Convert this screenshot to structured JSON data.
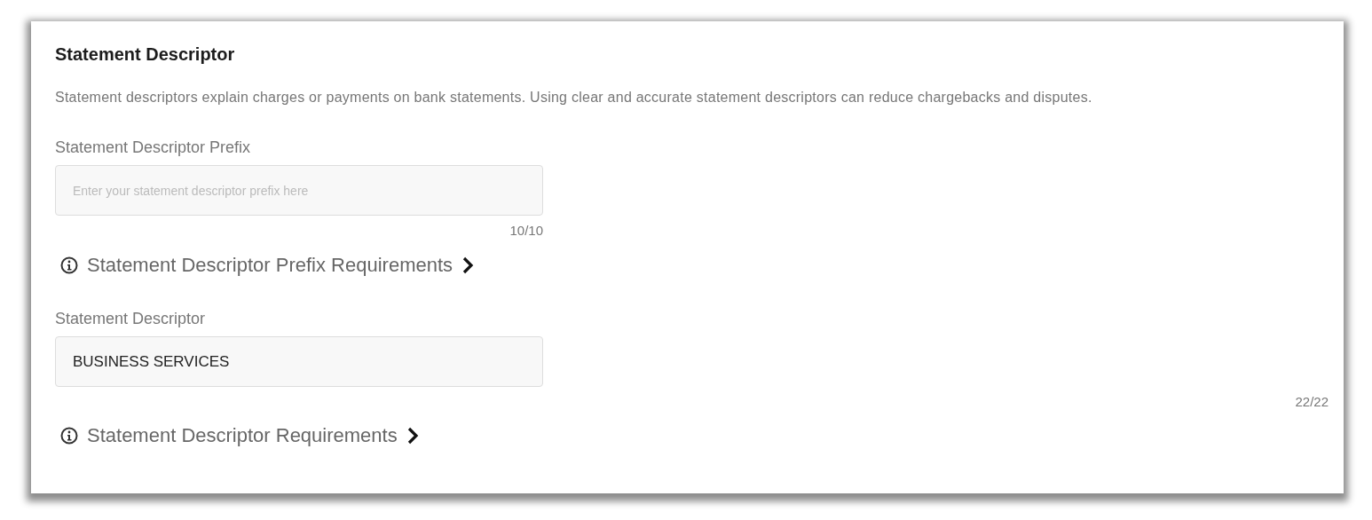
{
  "section": {
    "title": "Statement Descriptor",
    "description": "Statement descriptors explain charges or payments on bank statements. Using clear and accurate statement descriptors can reduce chargebacks and disputes."
  },
  "fields": [
    {
      "label": "Statement Descriptor Prefix",
      "placeholder": "Enter your statement descriptor prefix here",
      "counter": "10/10",
      "kind": "inline",
      "link": "Statement Descriptor Prefix Requirements"
    },
    {
      "label": "Statement Descriptor",
      "value": "BUSINESS SERVICES",
      "counter": "22/22",
      "kind": "wide",
      "link": "Statement Descriptor Requirements"
    }
  ]
}
